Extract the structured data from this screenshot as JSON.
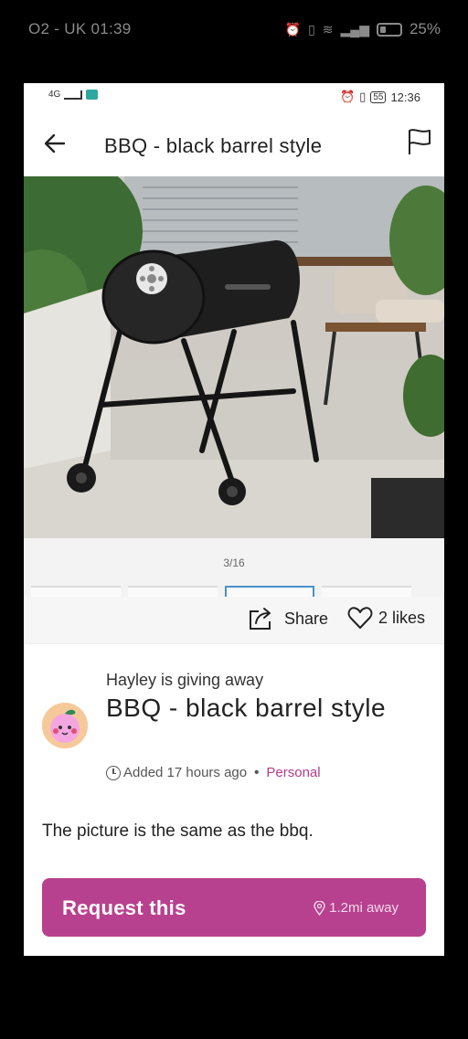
{
  "outer_status": {
    "carrier_time": "O2 - UK 01:39",
    "battery": "25%"
  },
  "inner_status": {
    "network": "4G",
    "battery_level": "55",
    "time": "12:36"
  },
  "header": {
    "title": "BBQ - black barrel style",
    "back_icon": "back-arrow-icon",
    "report_icon": "flag-icon"
  },
  "gallery": {
    "counter": "3/16",
    "thumbnail_count": 5,
    "active_thumbnail": 3
  },
  "actions": {
    "share_label": "Share",
    "likes_label": "2 likes"
  },
  "listing": {
    "giver_line": "Hayley is giving away",
    "title": "BBQ - black barrel style",
    "added": "Added 17 hours ago",
    "separator": "•",
    "tag": "Personal",
    "description": "The picture is the same as the bbq."
  },
  "request": {
    "label": "Request this",
    "distance": "1.2mi away"
  },
  "colors": {
    "accent": "#b8418f",
    "tag": "#b13d8d"
  }
}
